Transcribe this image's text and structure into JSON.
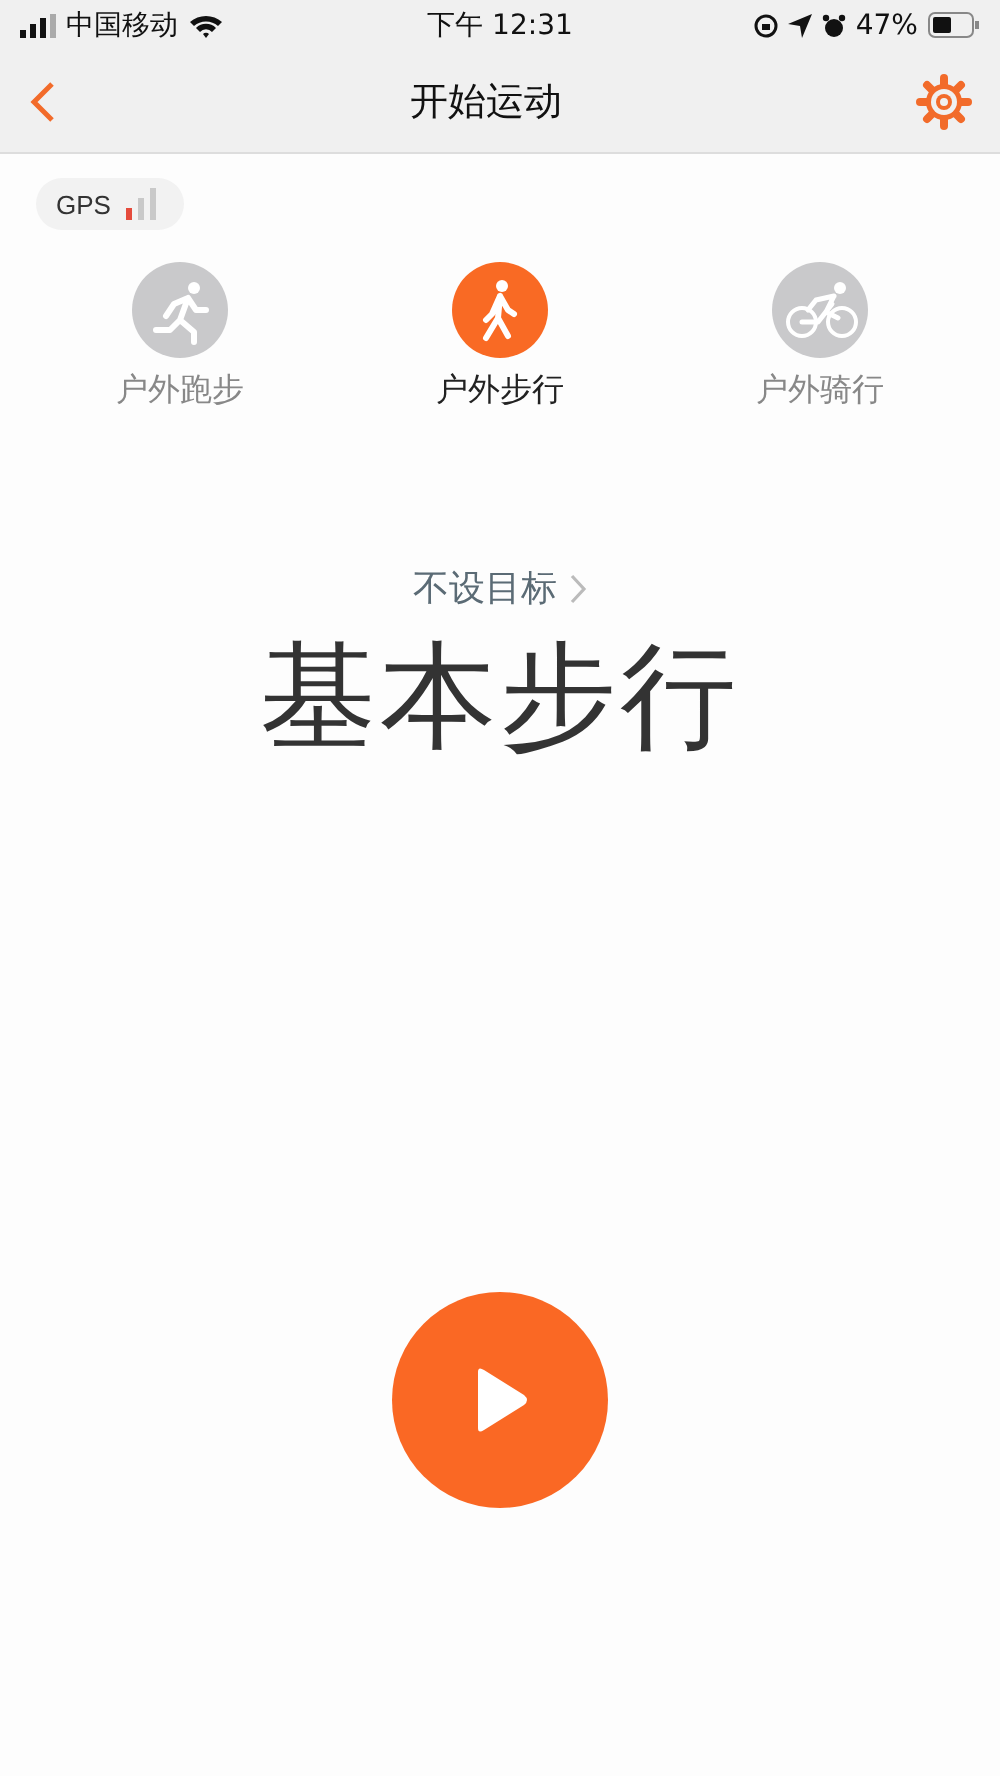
{
  "status_bar": {
    "carrier": "中国移动",
    "time": "下午 12:31",
    "battery": "47%"
  },
  "nav": {
    "title": "开始运动"
  },
  "gps": {
    "label": "GPS"
  },
  "modes": [
    {
      "kind": "run",
      "label": "户外跑步",
      "selected": false
    },
    {
      "kind": "walk",
      "label": "户外步行",
      "selected": true
    },
    {
      "kind": "ride",
      "label": "户外骑行",
      "selected": false
    }
  ],
  "goal": {
    "label": "不设目标"
  },
  "workout": {
    "title": "基本步行"
  }
}
